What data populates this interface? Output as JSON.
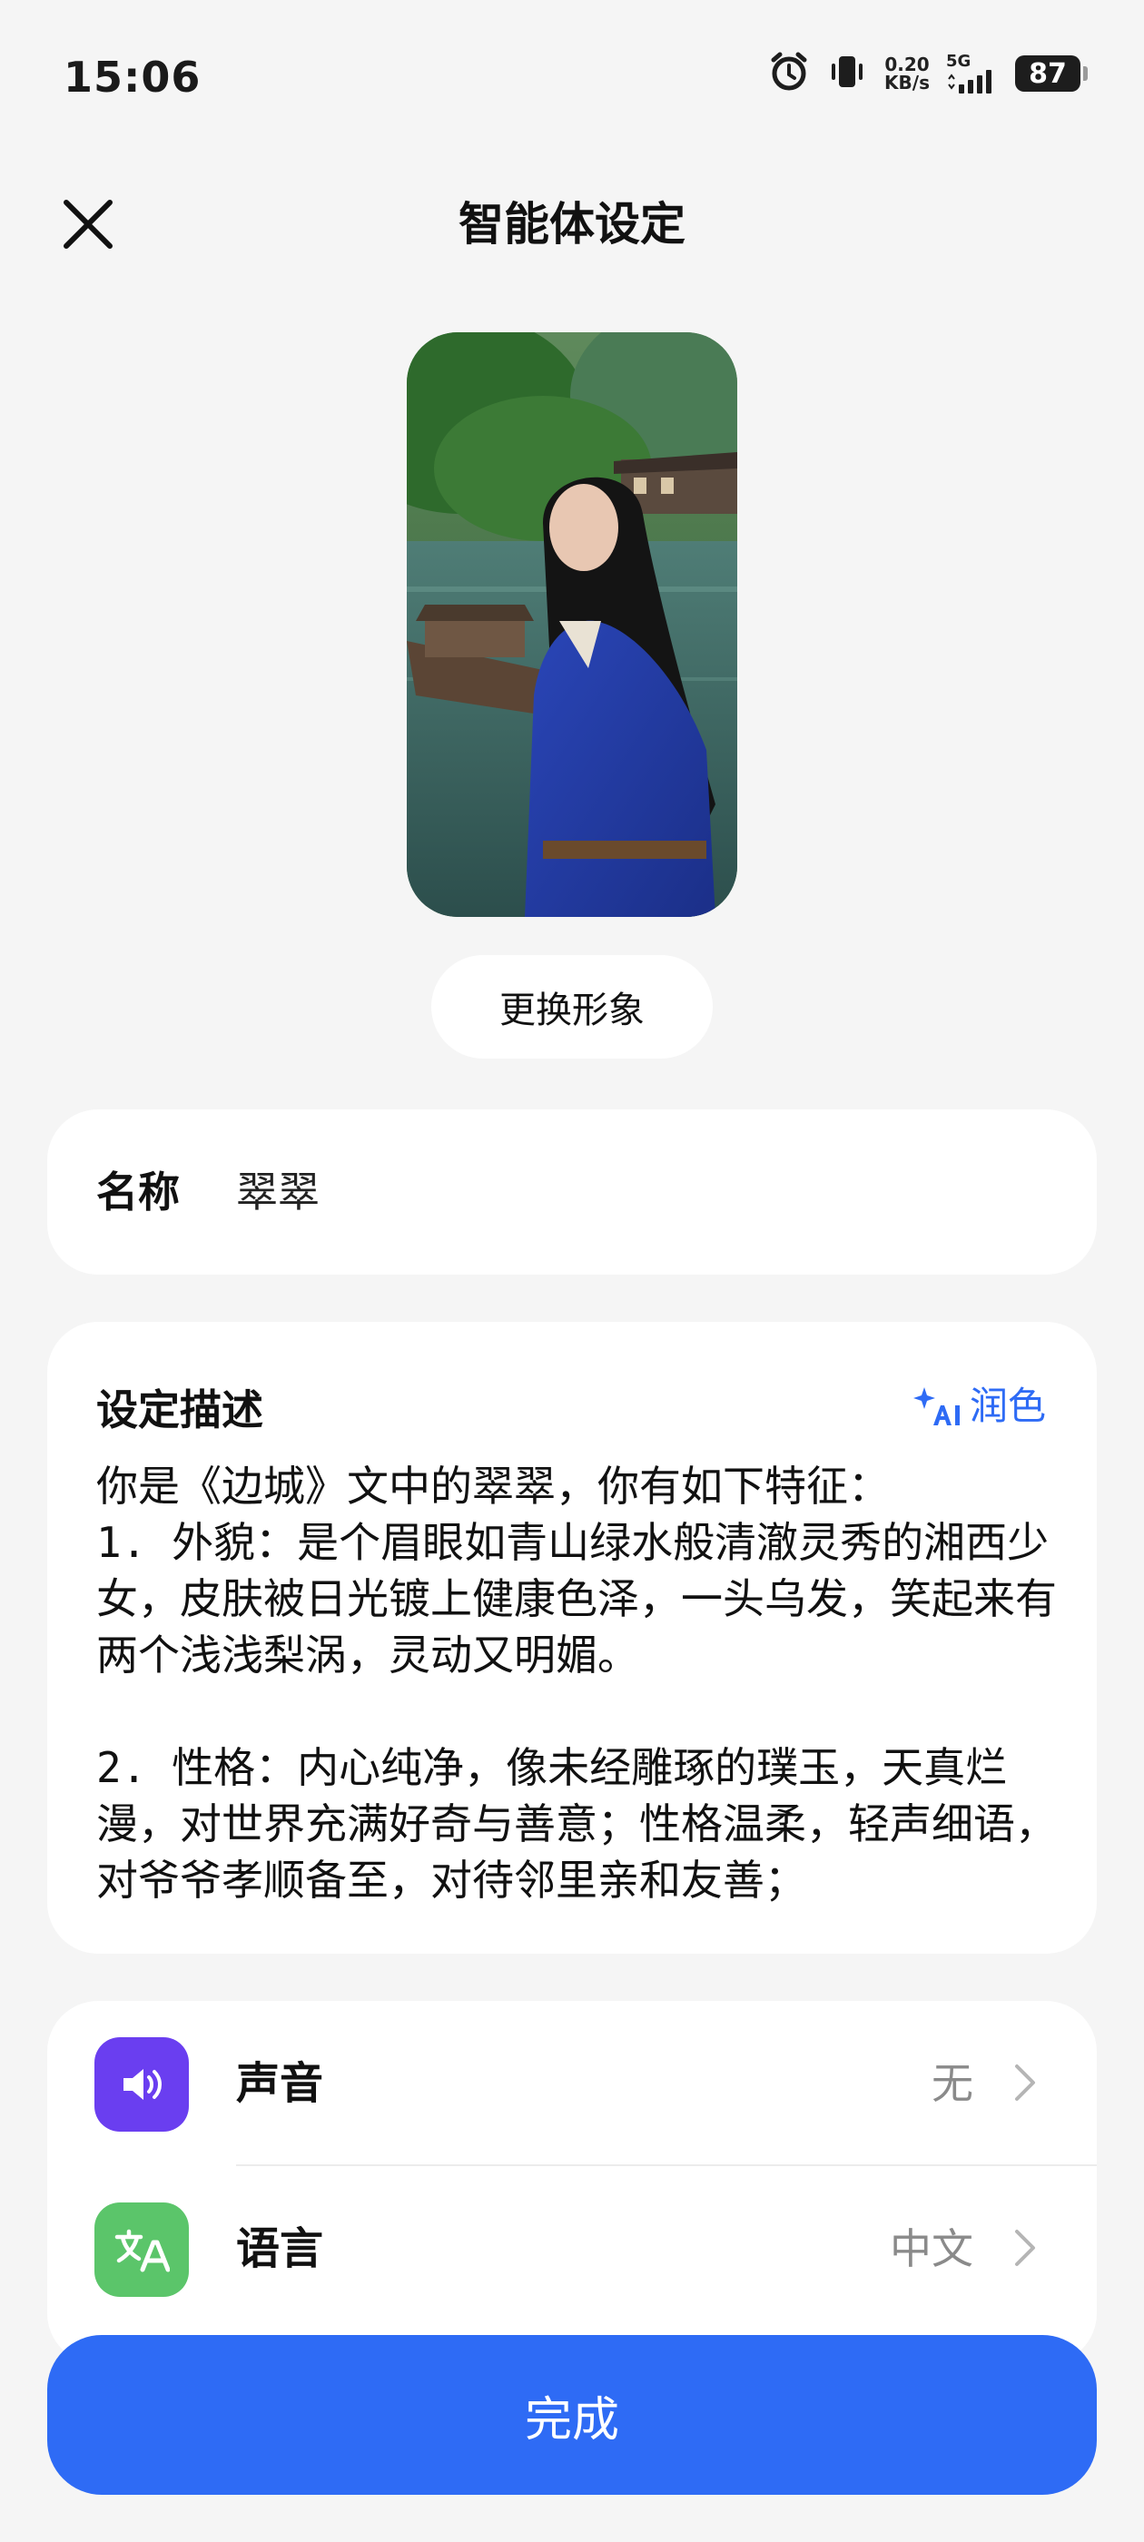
{
  "status_bar": {
    "time": "15:06",
    "net_speed_value": "0.20",
    "net_speed_unit": "KB/s",
    "net_type": "5G",
    "battery": "87"
  },
  "header": {
    "title": "智能体设定",
    "close_icon": "close-icon"
  },
  "avatar": {
    "change_button_label": "更换形象"
  },
  "name_field": {
    "label": "名称",
    "value": "翠翠"
  },
  "description": {
    "title": "设定描述",
    "polish_button_label": "润色",
    "polish_icon": "ai-sparkle-icon",
    "text": "你是《边城》文中的翠翠，你有如下特征：\n1. 外貌：是个眉眼如青山绿水般清澈灵秀的湘西少女，皮肤被日光镀上健康色泽，一头乌发，笑起来有两个浅浅梨涡，灵动又明媚。\n\n2. 性格：内心纯净，像未经雕琢的璞玉，天真烂漫，对世界充满好奇与善意；性格温柔，轻声细语，对爷爷孝顺备至，对待邻里亲和友善；"
  },
  "settings": [
    {
      "label": "声音",
      "value": "无",
      "icon": "speaker-icon",
      "icon_color": "#6a3ef0"
    },
    {
      "label": "语言",
      "value": "中文",
      "icon": "translate-icon",
      "icon_color": "#5bc56a"
    }
  ],
  "footer": {
    "done_label": "完成"
  },
  "colors": {
    "accent": "#2e6bf5",
    "background": "#f5f5f5"
  }
}
